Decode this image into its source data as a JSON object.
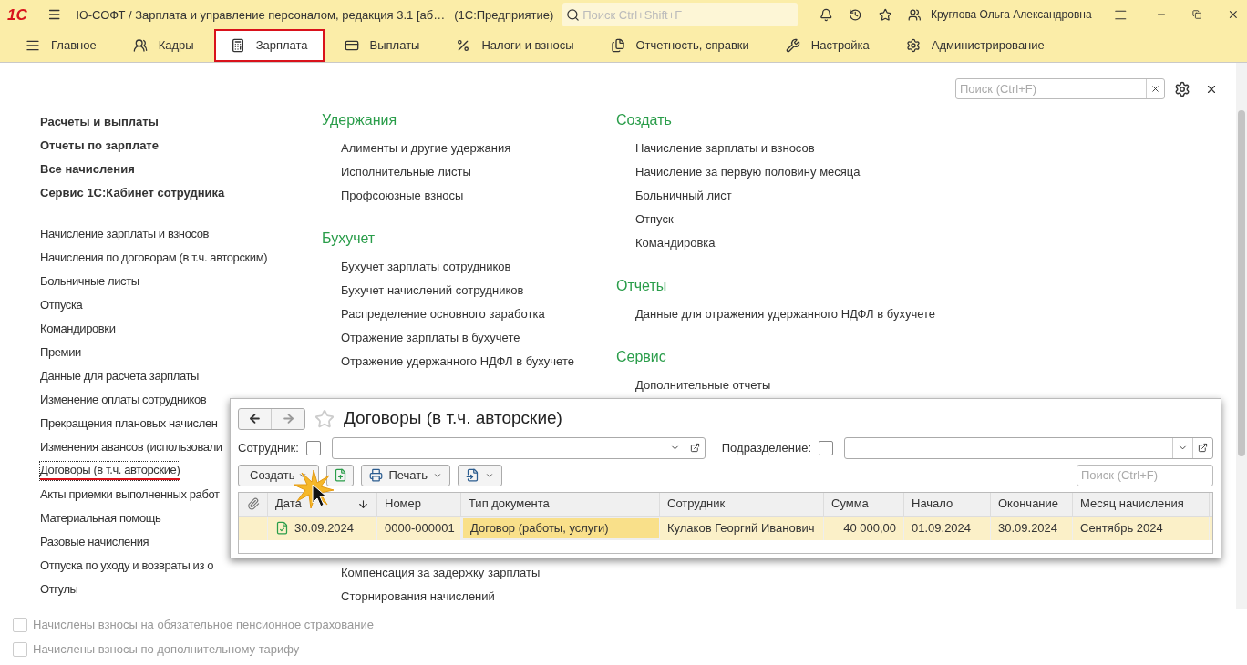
{
  "app_bar": {
    "logo": "1С",
    "title": "Ю-СОФТ / Зарплата и управление персоналом, редакция 3.1 [аб…",
    "subtitle": "(1С:Предприятие)",
    "search_placeholder": "Поиск Ctrl+Shift+F",
    "user": "Круглова Ольга Александровна"
  },
  "menu": [
    {
      "label": "Главное",
      "selected": false
    },
    {
      "label": "Кадры",
      "selected": false
    },
    {
      "label": "Зарплата",
      "selected": true
    },
    {
      "label": "Выплаты",
      "selected": false
    },
    {
      "label": "Налоги и взносы",
      "selected": false
    },
    {
      "label": "Отчетность, справки",
      "selected": false
    },
    {
      "label": "Настройка",
      "selected": false
    },
    {
      "label": "Администрирование",
      "selected": false
    }
  ],
  "panel": {
    "search_placeholder": "Поиск (Ctrl+F)",
    "main_links": [
      "Расчеты и выплаты",
      "Отчеты по зарплате",
      "Все начисления",
      "Сервис 1С:Кабинет сотрудника"
    ],
    "items": [
      {
        "label": "Начисление зарплаты и взносов",
        "selected": false
      },
      {
        "label": "Начисления по договорам (в т.ч. авторским)",
        "selected": false
      },
      {
        "label": "Больничные листы",
        "selected": false
      },
      {
        "label": "Отпуска",
        "selected": false
      },
      {
        "label": "Командировки",
        "selected": false
      },
      {
        "label": "Премии",
        "selected": false
      },
      {
        "label": "Данные для расчета зарплаты",
        "selected": false
      },
      {
        "label": "Изменение оплаты сотрудников",
        "selected": false
      },
      {
        "label": "Прекращения плановых начислен",
        "selected": false
      },
      {
        "label": "Изменения авансов (использовали",
        "selected": false
      },
      {
        "label": "Договоры (в т.ч. авторские)",
        "selected": true
      },
      {
        "label": "Акты приемки выполненных работ",
        "selected": false
      },
      {
        "label": "Материальная помощь",
        "selected": false
      },
      {
        "label": "Разовые начисления",
        "selected": false
      },
      {
        "label": "Отпуска по уходу и возвраты из о",
        "selected": false
      },
      {
        "label": "Отгулы",
        "selected": false
      }
    ],
    "middle_sections": [
      {
        "title": "Удержания",
        "items": [
          "Алименты и другие удержания",
          "Исполнительные листы",
          "Профсоюзные взносы"
        ]
      },
      {
        "title": "Бухучет",
        "items": [
          "Бухучет зарплаты сотрудников",
          "Бухучет начислений сотрудников",
          "Распределение основного заработка",
          "Отражение зарплаты в бухучете",
          "Отражение удержанного НДФЛ в бухучете"
        ]
      }
    ],
    "middle_tail": [
      "Компенсация за задержку зарплаты",
      "Сторнирования начислений"
    ],
    "right_sections": [
      {
        "title": "Создать",
        "items": [
          "Начисление зарплаты и взносов",
          "Начисление за первую половину месяца",
          "Больничный лист",
          "Отпуск",
          "Командировка"
        ]
      },
      {
        "title": "Отчеты",
        "items": [
          "Данные для отражения удержанного НДФЛ в бухучете"
        ]
      },
      {
        "title": "Сервис",
        "items": [
          "Дополнительные отчеты"
        ]
      }
    ]
  },
  "list_window": {
    "title": "Договоры (в т.ч. авторские)",
    "filters": [
      {
        "label": "Сотрудник:",
        "checked": false
      },
      {
        "label": "Подразделение:",
        "checked": false
      }
    ],
    "create_button": "Создать",
    "print_button": "Печать",
    "search_placeholder": "Поиск (Ctrl+F)",
    "columns": [
      {
        "kind": "attachment",
        "sorted": false
      },
      {
        "kind": "text",
        "label": "Дата",
        "sorted": true
      },
      {
        "kind": "text",
        "label": "Номер",
        "sorted": false
      },
      {
        "kind": "text",
        "label": "Тип документа",
        "sorted": false
      },
      {
        "kind": "text",
        "label": "Сотрудник",
        "sorted": false
      },
      {
        "kind": "number",
        "label": "Сумма",
        "sorted": false
      },
      {
        "kind": "text",
        "label": "Начало",
        "sorted": false
      },
      {
        "kind": "text",
        "label": "Окончание",
        "sorted": false
      },
      {
        "kind": "text",
        "label": "Месяц начисления",
        "sorted": false
      }
    ],
    "rows": [
      {
        "selected": true,
        "posted": true,
        "cells": [
          {
            "text": "",
            "focused": false
          },
          {
            "text": "30.09.2024",
            "focused": false
          },
          {
            "text": "0000-000001",
            "focused": false
          },
          {
            "text": "Договор (работы, услуги)",
            "focused": true
          },
          {
            "text": "Кулаков Георгий Иванович",
            "focused": false
          },
          {
            "text": "40 000,00",
            "focused": false
          },
          {
            "text": "01.09.2024",
            "focused": false
          },
          {
            "text": "30.09.2024",
            "focused": false
          },
          {
            "text": "Сентябрь 2024",
            "focused": false
          }
        ]
      }
    ]
  },
  "bottom_options": [
    {
      "label": "Начислены взносы на обязательное пенсионное страхование",
      "checked": false,
      "disabled": true
    },
    {
      "label": "Начислены взносы по дополнительному тарифу",
      "checked": false,
      "disabled": true
    }
  ]
}
